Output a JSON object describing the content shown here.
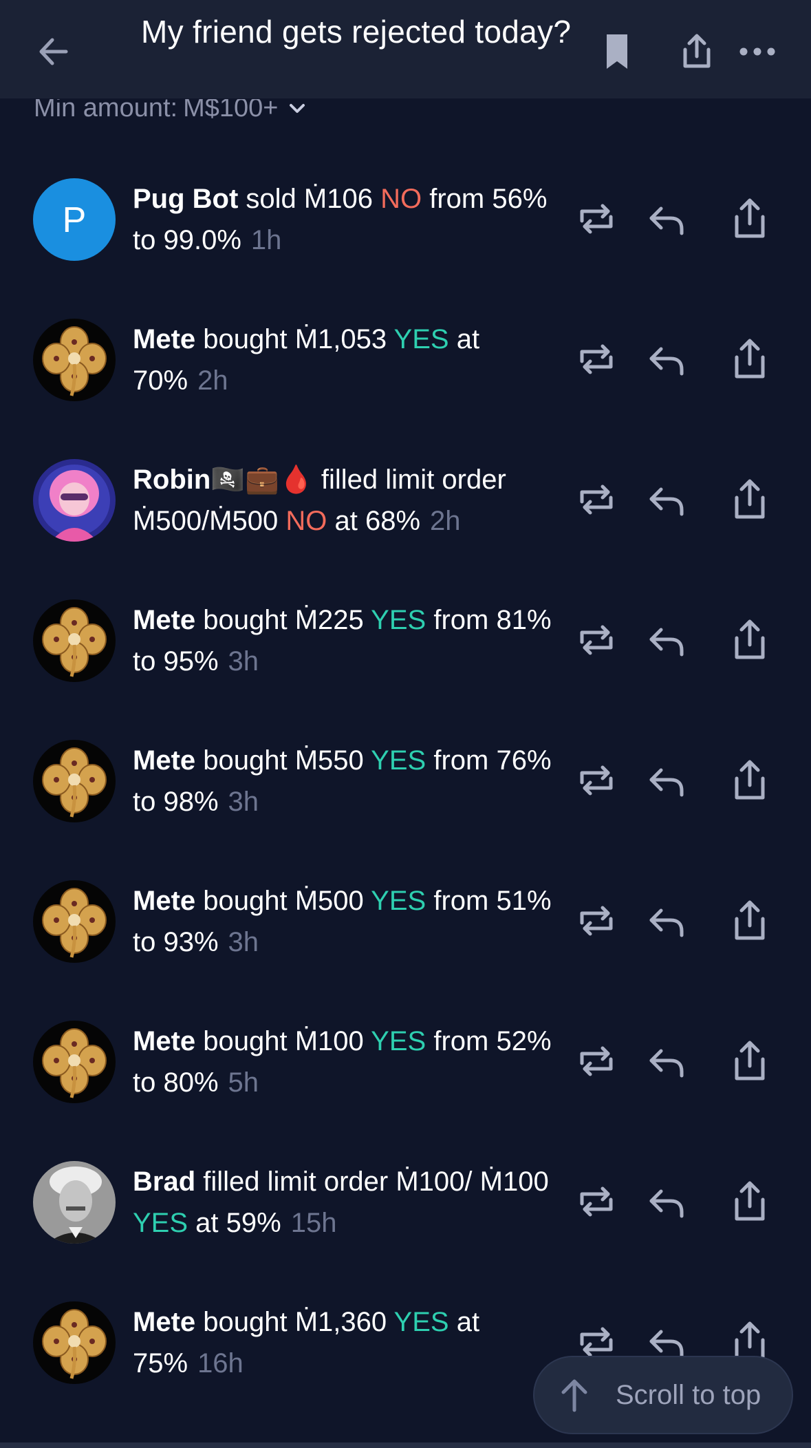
{
  "header": {
    "title": "My friend gets rejected today?"
  },
  "filter": {
    "label": "Min amount:",
    "value": "M$100+"
  },
  "currency_symbol": "Ṁ",
  "colors": {
    "background": "#0f1529",
    "header": "#1b2235",
    "yes": "#2ecfb0",
    "no": "#f26b5b",
    "muted": "#6d7590",
    "pug_bot_avatar": "#1a8fe0"
  },
  "feed": [
    {
      "user": "Pug Bot",
      "avatar": "pug-bot-avatar",
      "parts": [
        " sold ",
        "Ṁ106",
        " "
      ],
      "outcome": "NO",
      "outcome_class": "no",
      "tail": " from 56% to 99.0%",
      "time": "1h"
    },
    {
      "user": "Mete",
      "avatar": "clover-avatar",
      "parts": [
        " bought ",
        "Ṁ1,053",
        " "
      ],
      "outcome": "YES",
      "outcome_class": "yes",
      "tail": " at 70%",
      "time": "2h"
    },
    {
      "user": "Robin🏴‍☠️💼🩸",
      "avatar": "robin-avatar",
      "parts": [
        " filled limit order ",
        "Ṁ500/Ṁ500",
        " "
      ],
      "outcome": "NO",
      "outcome_class": "no",
      "tail": " at 68%",
      "time": "2h"
    },
    {
      "user": "Mete",
      "avatar": "clover-avatar",
      "parts": [
        " bought ",
        "Ṁ225",
        " "
      ],
      "outcome": "YES",
      "outcome_class": "yes",
      "tail": " from 81% to 95%",
      "time": "3h"
    },
    {
      "user": "Mete",
      "avatar": "clover-avatar",
      "parts": [
        " bought ",
        "Ṁ550",
        " "
      ],
      "outcome": "YES",
      "outcome_class": "yes",
      "tail": " from 76% to 98%",
      "time": "3h"
    },
    {
      "user": "Mete",
      "avatar": "clover-avatar",
      "parts": [
        " bought ",
        "Ṁ500",
        " "
      ],
      "outcome": "YES",
      "outcome_class": "yes",
      "tail": " from 51% to 93%",
      "time": "3h"
    },
    {
      "user": "Mete",
      "avatar": "clover-avatar",
      "parts": [
        " bought ",
        "Ṁ100",
        " "
      ],
      "outcome": "YES",
      "outcome_class": "yes",
      "tail": " from 52% to 80%",
      "time": "5h"
    },
    {
      "user": "Brad",
      "avatar": "brad-avatar",
      "parts": [
        " filled limit order ",
        "Ṁ100/ Ṁ100",
        " "
      ],
      "outcome": "YES",
      "outcome_class": "yes",
      "tail": " at 59%",
      "time": "15h"
    },
    {
      "user": "Mete",
      "avatar": "clover-avatar",
      "parts": [
        " bought ",
        "Ṁ1,360",
        " "
      ],
      "outcome": "YES",
      "outcome_class": "yes",
      "tail": " at 75%",
      "time": "16h"
    }
  ],
  "pug_bot_initial": "P",
  "scroll_to_top": {
    "label": "Scroll to top"
  }
}
